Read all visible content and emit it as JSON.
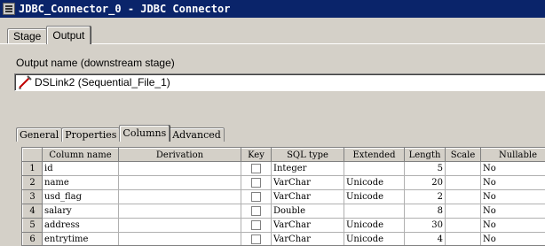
{
  "window": {
    "title": "JDBC_Connector_0 - JDBC Connector"
  },
  "top_tabs": [
    {
      "label": "Stage"
    },
    {
      "label": "Output"
    }
  ],
  "output": {
    "label": "Output name (downstream stage)",
    "value": "DSLink2 (Sequential_File_1)"
  },
  "sub_tabs": [
    {
      "label": "General"
    },
    {
      "label": "Properties"
    },
    {
      "label": "Columns"
    },
    {
      "label": "Advanced"
    }
  ],
  "columns_grid": {
    "headers": [
      "",
      "Column name",
      "Derivation",
      "Key",
      "SQL type",
      "Extended",
      "Length",
      "Scale",
      "Nullable"
    ],
    "rows": [
      {
        "n": "1",
        "name": "id",
        "derivation": "",
        "sql_type": "Integer",
        "extended": "",
        "length": "5",
        "scale": "",
        "nullable": "No"
      },
      {
        "n": "2",
        "name": "name",
        "derivation": "",
        "sql_type": "VarChar",
        "extended": "Unicode",
        "length": "20",
        "scale": "",
        "nullable": "No"
      },
      {
        "n": "3",
        "name": "usd_flag",
        "derivation": "",
        "sql_type": "VarChar",
        "extended": "Unicode",
        "length": "2",
        "scale": "",
        "nullable": "No"
      },
      {
        "n": "4",
        "name": "salary",
        "derivation": "",
        "sql_type": "Double",
        "extended": "",
        "length": "8",
        "scale": "",
        "nullable": "No"
      },
      {
        "n": "5",
        "name": "address",
        "derivation": "",
        "sql_type": "VarChar",
        "extended": "Unicode",
        "length": "30",
        "scale": "",
        "nullable": "No"
      },
      {
        "n": "6",
        "name": "entrytime",
        "derivation": "",
        "sql_type": "VarChar",
        "extended": "Unicode",
        "length": "4",
        "scale": "",
        "nullable": "No"
      }
    ]
  },
  "icons": {
    "window": "app-icon",
    "link": "link-pencil-icon"
  }
}
